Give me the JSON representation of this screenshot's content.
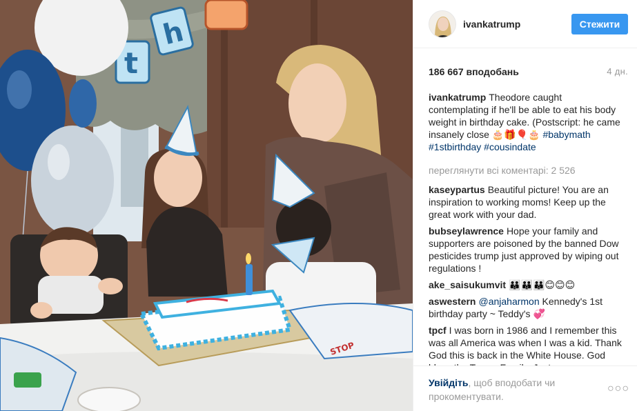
{
  "post": {
    "username": "ivankatrump",
    "follow_label": "Стежити",
    "likes": "186 667 вподобань",
    "time_ago": "4 дн.",
    "caption": {
      "user": "ivankatrump",
      "text": "Theodore caught contemplating if he'll be able to eat his body weight in birthday cake. (Postscript: he came insanely close 🎂🎁🎈🎂",
      "hashtags": "#babymath #1stbirthday #cousindate"
    },
    "view_all_comments": "переглянути всі коментарі: 2 526",
    "comments": [
      {
        "user": "kaseypartus",
        "mention": "",
        "text": "Beautiful picture! You are an inspiration to working moms! Keep up the great work with your dad."
      },
      {
        "user": "bubseylawrence",
        "mention": "",
        "text": "Hope your family and supporters are poisoned by the banned Dow pesticides trump just approved by wiping out regulations !"
      },
      {
        "user": "ake_saisukumvit",
        "mention": "",
        "text": "👪👪👪😊😊😊"
      },
      {
        "user": "aswestern",
        "mention": "@anjaharmon",
        "text": "Kennedy's 1st birthday party ~ Teddy's 💞"
      },
      {
        "user": "tpcf",
        "mention": "",
        "text": "I was born in 1986 and I remember this was all America was when I was a kid. Thank God this is back in the White House. God bless the Trump Family. Just"
      }
    ],
    "footer": {
      "login_link": "Увійдіть",
      "login_rest": ", щоб вподобати чи прокоментувати."
    },
    "more_icon": "more-horizontal-icon"
  },
  "colors": {
    "accent": "#3897f0",
    "link": "#003569",
    "muted": "#999999",
    "text": "#262626"
  }
}
